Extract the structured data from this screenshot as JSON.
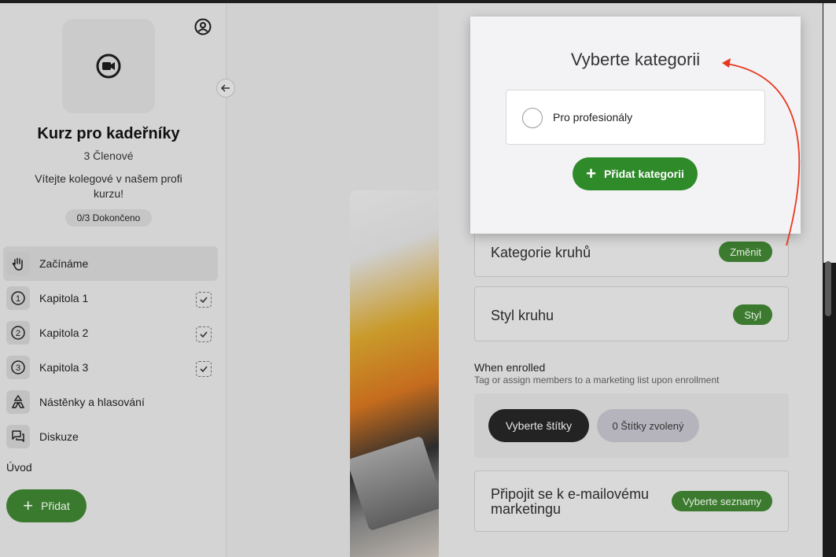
{
  "sidebar": {
    "course_title": "Kurz pro kadeřníky",
    "members": "3 Členové",
    "welcome": "Vítejte kolegové v našem profi kurzu!",
    "progress": "0/3 Dokončeno",
    "items": [
      {
        "label": "Začínáme",
        "icon": "hand-icon",
        "active": true
      },
      {
        "label": "Kapitola 1",
        "icon": "number-1-icon",
        "checked": true
      },
      {
        "label": "Kapitola 2",
        "icon": "number-2-icon",
        "checked": true
      },
      {
        "label": "Kapitola 3",
        "icon": "number-3-icon",
        "checked": true
      },
      {
        "label": "Nástěnky a hlasování",
        "icon": "poll-icon"
      },
      {
        "label": "Diskuze",
        "icon": "chat-icon"
      }
    ],
    "section_label": "Úvod",
    "add_label": "Přidat"
  },
  "popup": {
    "title": "Vyberte kategorii",
    "option_label": "Pro profesionály",
    "add_label": "Přidat kategorii"
  },
  "panel": {
    "category_title": "Kategorie kruhů",
    "category_button": "Změnit",
    "style_title": "Styl kruhu",
    "style_button": "Styl",
    "enroll_title": "When enrolled",
    "enroll_sub": "Tag or assign members to a marketing list upon enrollment",
    "select_tags": "Vyberte štítky",
    "tags_selected": "0 Štítky zvolený",
    "email_title": "Připojit se k e-mailovému marketingu",
    "email_button": "Vyberte seznamy"
  },
  "colors": {
    "accent_green": "#2f8a2a",
    "annotation_red": "#e8381f"
  }
}
